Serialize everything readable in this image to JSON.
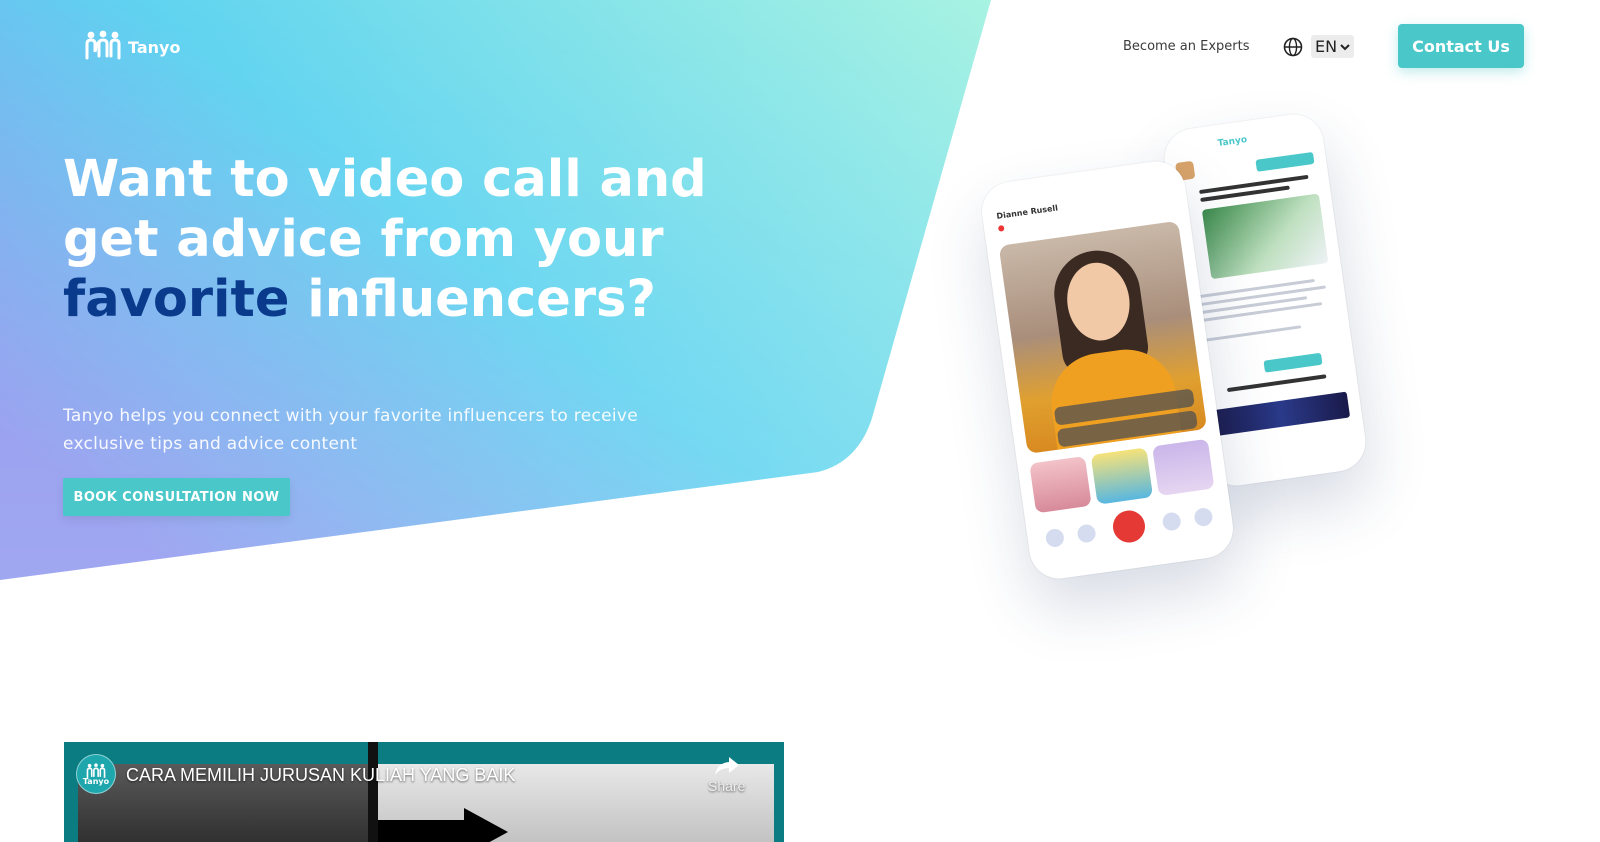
{
  "brand": {
    "name": "Tanyo"
  },
  "nav": {
    "experts_link": "Become an Experts",
    "language": "EN",
    "contact_label": "Contact Us"
  },
  "hero": {
    "title_part1": "Want to video call and get advice from your ",
    "title_highlight": "favorite",
    "title_part2": " influencers?",
    "subtitle": "Tanyo helps you connect with your favorite influencers to receive exclusive tips and advice content",
    "cta_label": "BOOK CONSULTATION NOW"
  },
  "phone_front": {
    "caller_name": "Dianne Rusell"
  },
  "video": {
    "title": "CARA MEMILIH JURUSAN KULIAH YANG BAIK",
    "share_label": "Share",
    "channel": "Tanyo"
  },
  "colors": {
    "accent": "#4ac7c9",
    "highlight_text": "#0a3a8c",
    "gradient": [
      "#8c94ee",
      "#5fd3f0",
      "#a8f3e2"
    ]
  },
  "icons": [
    "tanyo-logo-icon",
    "globe-icon",
    "chevron-down-icon",
    "share-icon",
    "end-call-icon"
  ]
}
